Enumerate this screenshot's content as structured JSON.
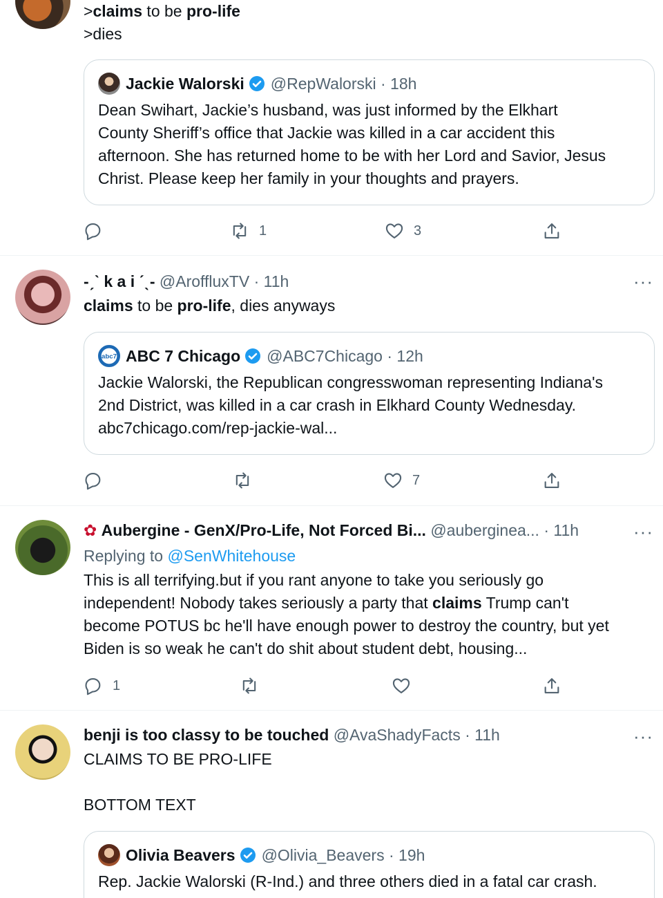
{
  "tweets": [
    {
      "lines": [
        ">",
        "claims",
        " to be ",
        "pro-life",
        ">dies"
      ],
      "quote": {
        "name": "Jackie Walorski",
        "handle": "@RepWalorski · 18h",
        "lines": [
          "Dean Swihart, Jackie’s husband, was just informed by the Elkhart",
          "County Sheriff’s office that Jackie was killed in a car accident this",
          "afternoon. She has returned home to be with her Lord and Savior, Jesus",
          "Christ. Please keep her family in your thoughts and prayers."
        ]
      },
      "actions": {
        "reply": "",
        "retweet": "1",
        "like": "3"
      }
    },
    {
      "name": "-ˏˋ k a i ˊˎ-",
      "handle": "@AroffluxTV · 11h",
      "text": {
        "a": "claims",
        "b": " to be ",
        "c": "pro-life",
        "d": ", dies anyways"
      },
      "quote": {
        "name": "ABC 7 Chicago",
        "handle": "@ABC7Chicago · 12h",
        "lines": [
          "Jackie Walorski, the Republican congresswoman representing Indiana's",
          "2nd District, was killed in a car crash in Elkhard County Wednesday.",
          "abc7chicago.com/rep-jackie-wal..."
        ]
      },
      "actions": {
        "reply": "",
        "retweet": "",
        "like": "7"
      }
    },
    {
      "name": "Aubergine - GenX/Pro-Life, Not Forced Bi...",
      "handle": "@auberginea...",
      "time": "· 11h",
      "replying_label": "Replying to",
      "replying_to": "@SenWhitehouse",
      "lines": [
        "This is all terrifying.but if you rant anyone to take you seriously go",
        "independent! Nobody takes seriously a party that ",
        "claims",
        " Trump can't",
        "become POTUS bc he'll have enough power to destroy the country, but yet",
        "Biden is so weak he can't do shit about student debt, housing..."
      ],
      "actions": {
        "reply": "1",
        "retweet": "",
        "like": ""
      }
    },
    {
      "name": "benji is too classy to be touched",
      "handle": "@AvaShadyFacts · 11h",
      "line1": "CLAIMS TO BE PRO-LIFE",
      "line2": "BOTTOM TEXT",
      "quote": {
        "name": "Olivia Beavers",
        "handle": "@Olivia_Beavers · 19h",
        "lines": [
          "Rep. Jackie Walorski (R-Ind.) and three others died in a fatal car crash."
        ]
      }
    }
  ],
  "more_label": "···",
  "colors": {
    "accent": "#1d9bf0",
    "text": "#0f1419",
    "muted": "#536471",
    "border": "#cfd9de"
  }
}
